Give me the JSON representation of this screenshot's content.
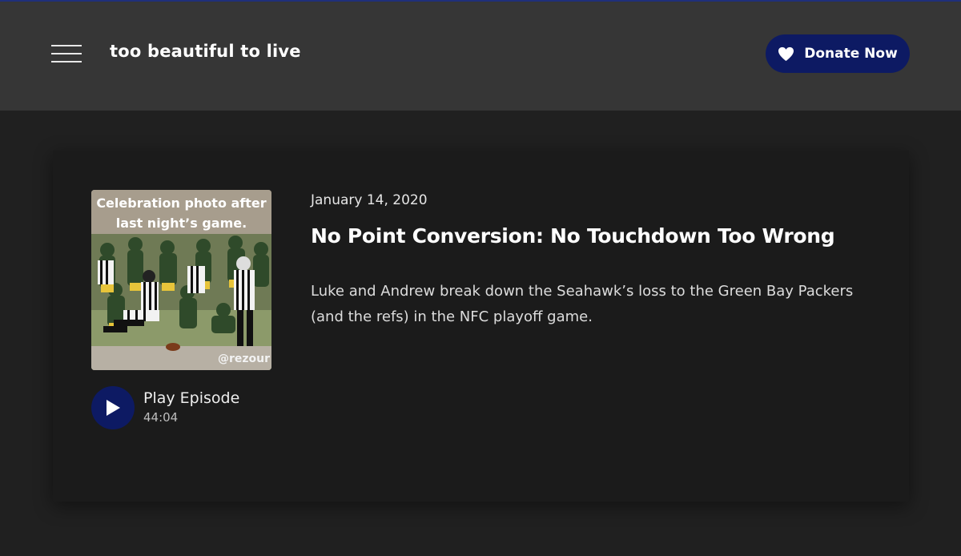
{
  "header": {
    "site_title": "too beautiful to live",
    "menu_icon": "hamburger-menu-icon",
    "donate_label": "Donate Now",
    "donate_icon": "heart-icon"
  },
  "episode": {
    "date": "January 14, 2020",
    "title": "No Point Conversion: No Touchdown Too Wrong",
    "description": "Luke and Andrew break down the Seahawk’s loss to the Green Bay Packers (and the refs) in the NFC playoff game.",
    "artwork": {
      "caption_line1": "Celebration photo after",
      "caption_line2": "last night’s game.",
      "handle": "@rezour"
    },
    "player": {
      "play_label": "Play Episode",
      "duration": "44:04",
      "play_icon": "play-icon"
    }
  },
  "colors": {
    "accent": "#0d1a63",
    "header_bg": "#363636",
    "page_bg": "#202020",
    "card_bg": "#1b1b1b"
  }
}
